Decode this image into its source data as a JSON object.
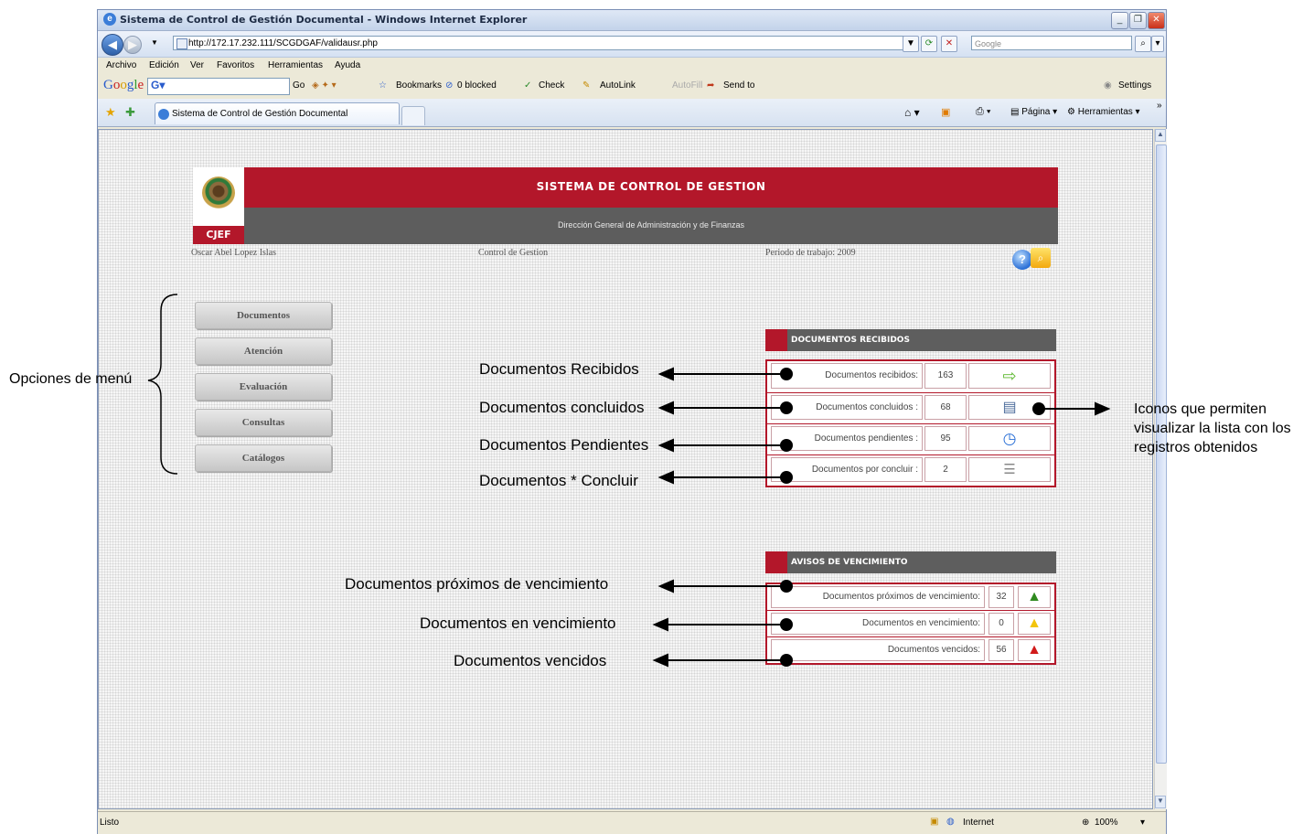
{
  "window": {
    "title": "Sistema de Control de Gestión Documental - Windows Internet Explorer",
    "url": "http://172.17.232.111/SCGDGAF/validausr.php",
    "search_placeholder": "Google",
    "menu": [
      "Archivo",
      "Edición",
      "Ver",
      "Favoritos",
      "Herramientas",
      "Ayuda"
    ],
    "google_toolbar": {
      "go": "Go",
      "bookmarks": "Bookmarks",
      "blocked": "0 blocked",
      "check": "Check",
      "autolink": "AutoLink",
      "autofill": "AutoFill",
      "sendto": "Send to",
      "settings": "Settings"
    },
    "tab_title": "Sistema de Control de Gestión Documental",
    "command_bar": {
      "page": "Página",
      "tools": "Herramientas"
    },
    "status": {
      "left": "Listo",
      "zone": "Internet",
      "zoom": "100%"
    }
  },
  "page": {
    "logo_text": "CJEF",
    "title": "SISTEMA DE CONTROL DE GESTION",
    "subtitle": "Dirección General de Administración y de Finanzas",
    "user": "Oscar Abel Lopez Islas",
    "module": "Control de Gestion",
    "period": "Periodo de trabajo: 2009",
    "menu": [
      "Documentos",
      "Atención",
      "Evaluación",
      "Consultas",
      "Catálogos"
    ],
    "received_panel": {
      "header": "DOCUMENTOS RECIBIDOS",
      "rows": [
        {
          "label": "Documentos recibidos:",
          "value": "163",
          "icon": "arrow-right-icon"
        },
        {
          "label": "Documentos concluidos :",
          "value": "68",
          "icon": "document-icon"
        },
        {
          "label": "Documentos pendientes :",
          "value": "95",
          "icon": "clock-icon"
        },
        {
          "label": "Documentos por concluir :",
          "value": "2",
          "icon": "document-list-icon"
        }
      ]
    },
    "expiry_panel": {
      "header": "AVISOS DE VENCIMIENTO",
      "rows": [
        {
          "label": "Documentos próximos de vencimiento:",
          "value": "32",
          "color": "#2f8a1f"
        },
        {
          "label": "Documentos en vencimiento:",
          "value": "0",
          "color": "#f2c40c"
        },
        {
          "label": "Documentos vencidos:",
          "value": "56",
          "color": "#d11a1a"
        }
      ]
    }
  },
  "annotations": {
    "menu_options": "Opciones de menú",
    "received": "Documentos Recibidos",
    "concluded": "Documentos concluidos",
    "pending": "Documentos Pendientes",
    "to_conclude": "Documentos * Concluir",
    "near_expiry": "Documentos próximos de vencimiento",
    "in_expiry": "Documentos en vencimiento",
    "expired": "Documentos vencidos",
    "icons_note": "Iconos que permiten visualizar la lista con los registros obtenidos"
  }
}
